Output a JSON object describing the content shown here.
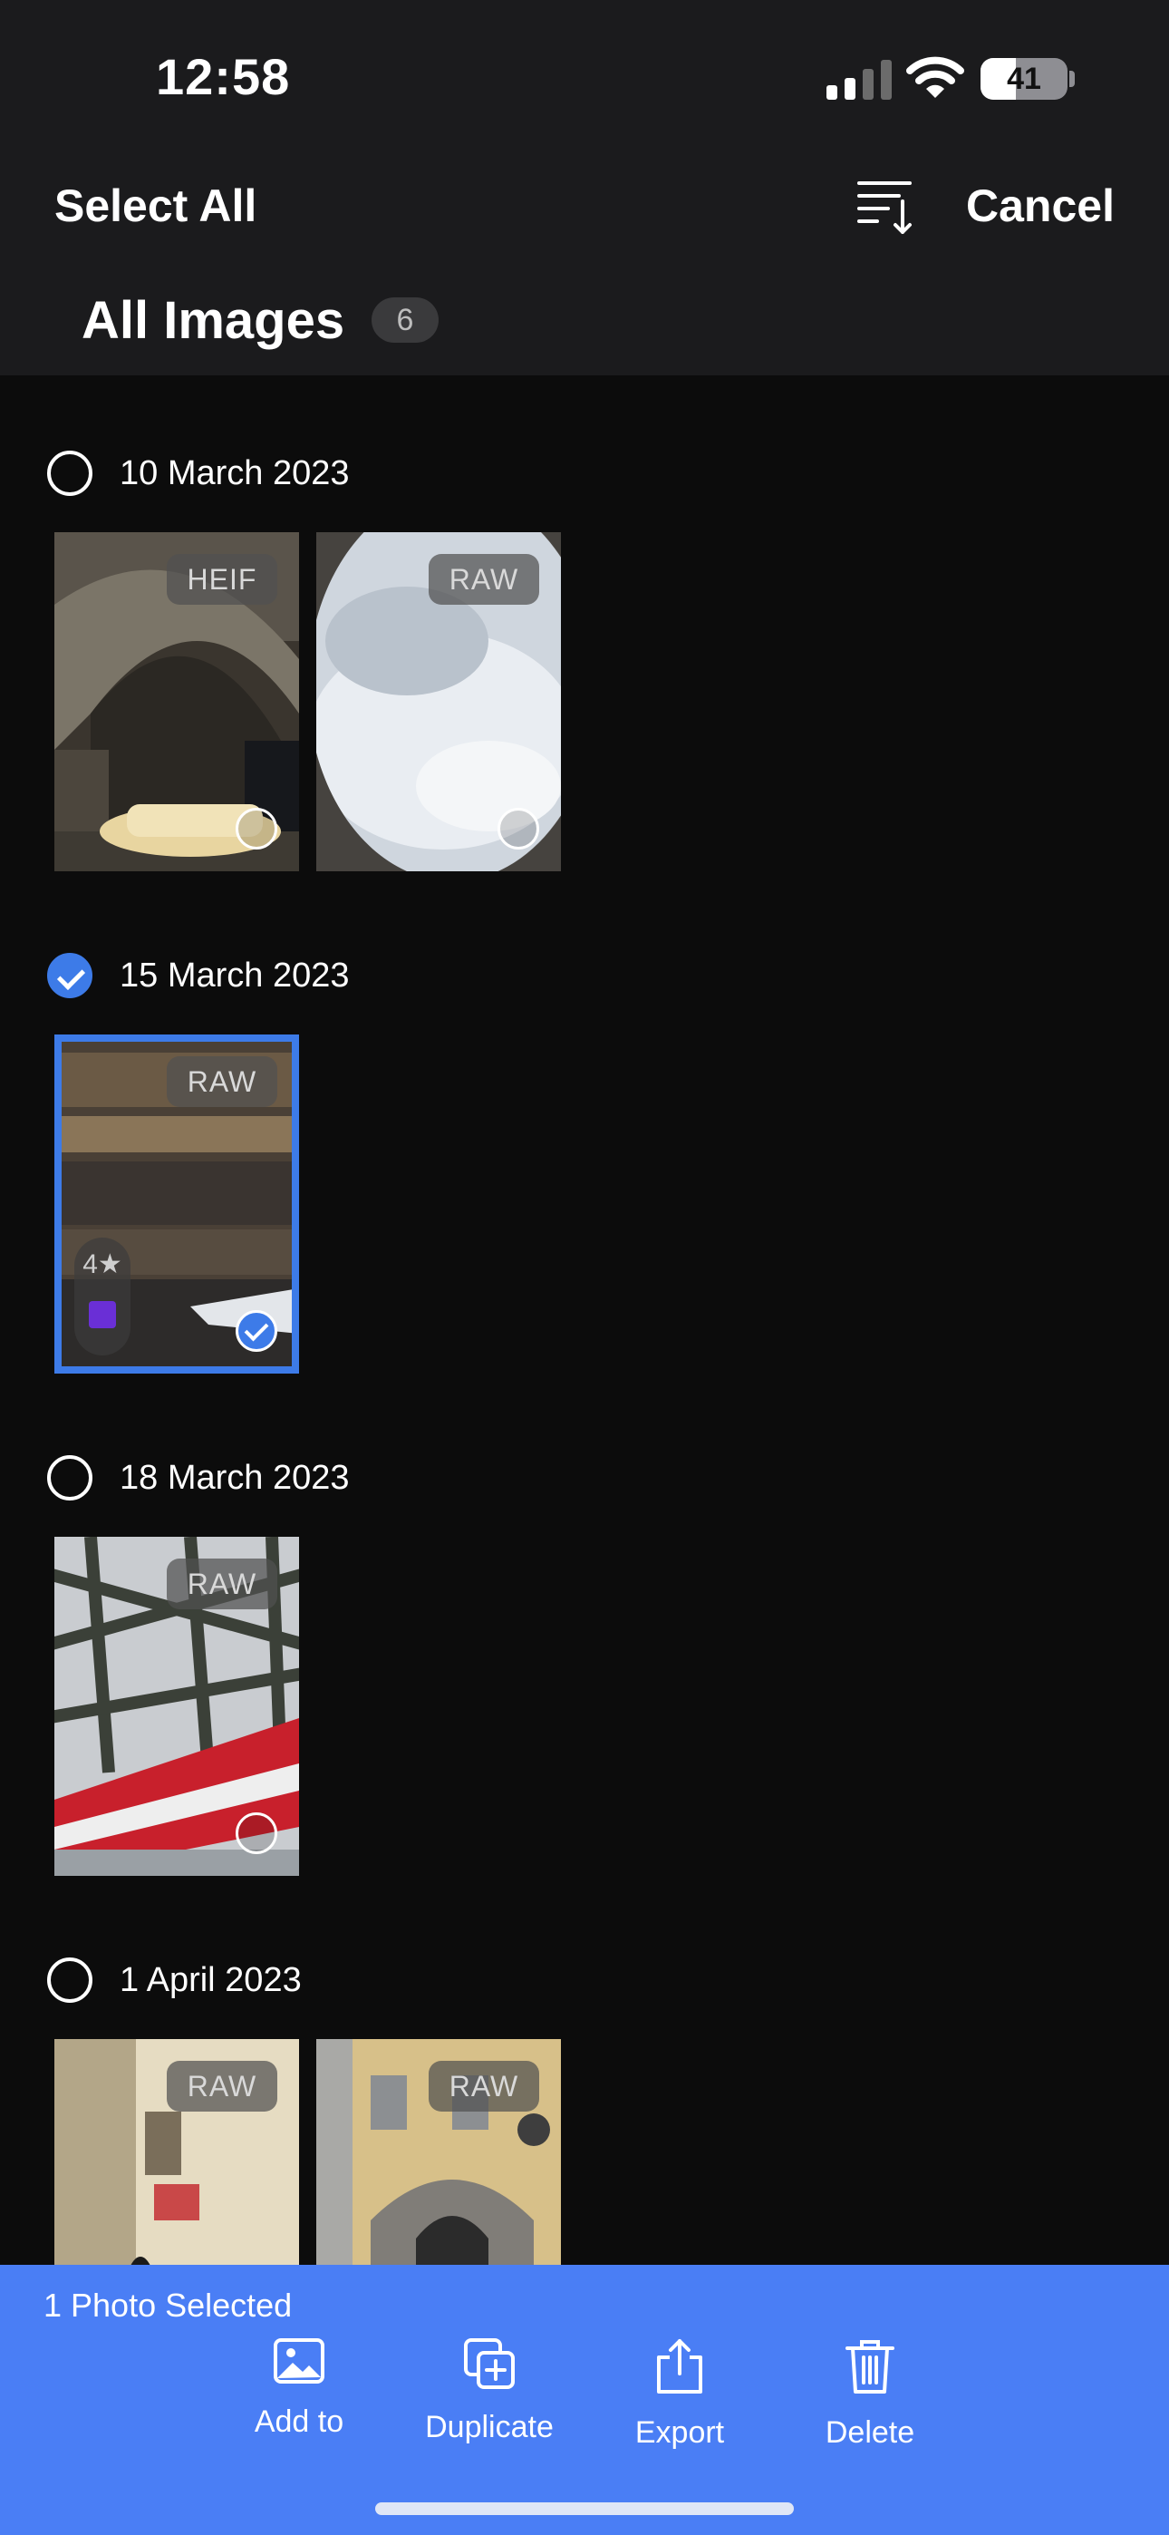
{
  "status_bar": {
    "time": "12:58",
    "battery_percent": "41",
    "battery_level": 0.41
  },
  "header": {
    "select_all_label": "Select All",
    "cancel_label": "Cancel",
    "title": "All Images",
    "count": "6"
  },
  "groups": [
    {
      "date": "10 March 2023",
      "selected": false,
      "photos": [
        {
          "format": "HEIF"
        },
        {
          "format": "RAW"
        }
      ]
    },
    {
      "date": "15 March 2023",
      "selected": true,
      "photos": [
        {
          "format": "RAW",
          "rating": "4★",
          "color_tag": "#6a2fd6",
          "selected": true
        }
      ]
    },
    {
      "date": "18 March 2023",
      "selected": false,
      "photos": [
        {
          "format": "RAW"
        }
      ]
    },
    {
      "date": "1 April 2023",
      "selected": false,
      "photos": [
        {
          "format": "RAW"
        },
        {
          "format": "RAW"
        }
      ]
    }
  ],
  "action_bar": {
    "status": "1 Photo Selected",
    "actions": [
      {
        "label": "Add to",
        "icon": "photo-icon"
      },
      {
        "label": "Duplicate",
        "icon": "duplicate-icon"
      },
      {
        "label": "Export",
        "icon": "share-icon"
      },
      {
        "label": "Delete",
        "icon": "trash-icon"
      }
    ]
  },
  "colors": {
    "accent": "#4a7ef5",
    "check": "#3d7be8",
    "background": "#0c0c0c",
    "header": "#1b1b1d"
  }
}
